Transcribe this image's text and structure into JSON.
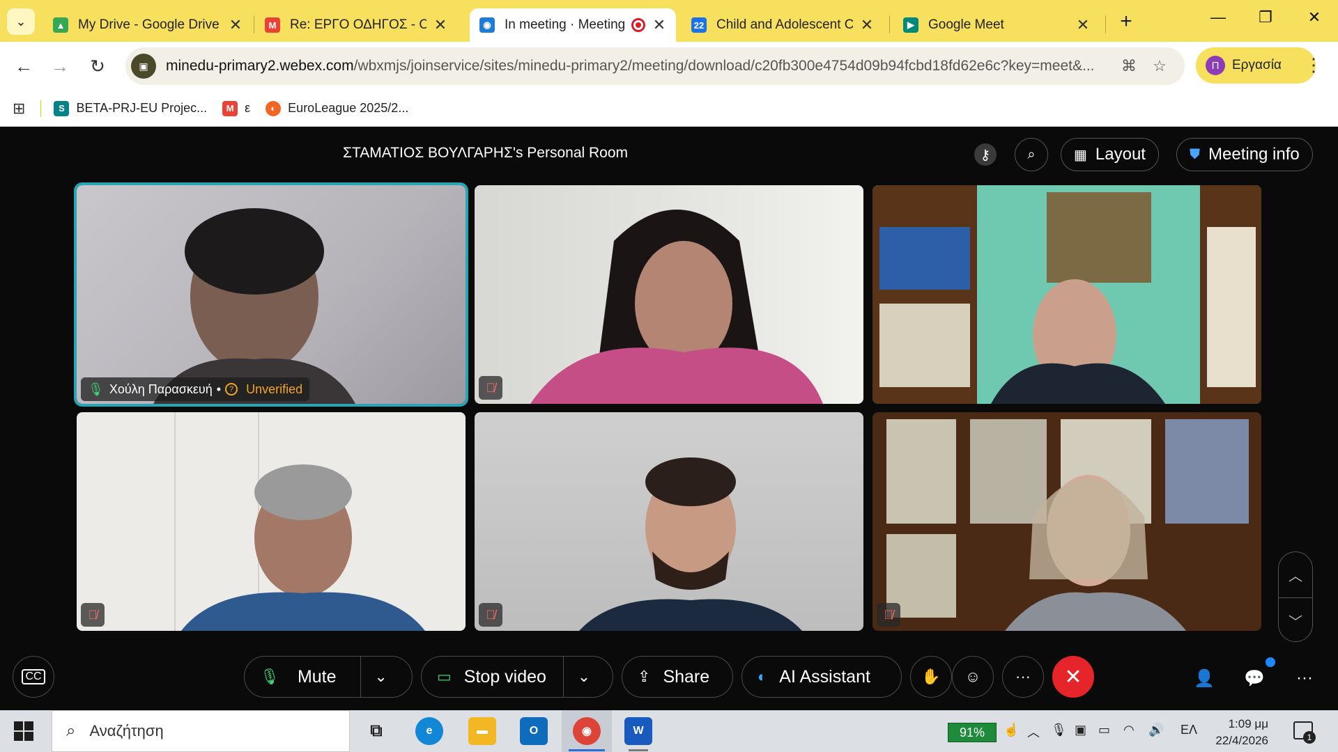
{
  "browser": {
    "tabs": [
      {
        "title": "My Drive - Google Drive",
        "icon": "google-drive-icon",
        "color": "#34a853"
      },
      {
        "title": "Re: ΕΡΓΟ ΟΔΗΓΟΣ - ΟΡΙΣ",
        "icon": "gmail-icon",
        "color": "#ea4335"
      },
      {
        "title": "In meeting · Meeting",
        "icon": "webex-icon",
        "color": "#1e7bd8",
        "active": true,
        "recording": true
      },
      {
        "title": "Child and Adolescent Cer",
        "icon": "calendar-icon",
        "color": "#1a73e8"
      },
      {
        "title": "Google Meet",
        "icon": "google-meet-icon",
        "color": "#00897b"
      }
    ],
    "url_host": "minedu-primary2.webex.com",
    "url_path": "/wbxmjs/joinservice/sites/minedu-primary2/meeting/download/c20fb300e4754d09b94fcbd18fd62e6c?key=meet&...",
    "profile_initial": "Π",
    "profile_name": "Εργασία",
    "bookmarks": [
      {
        "label": "BETA-PRJ-EU Projec...",
        "icon": "sharepoint-icon",
        "color": "#038387"
      },
      {
        "label": "ε",
        "icon": "gmail-icon",
        "color": "#ea4335"
      },
      {
        "label": "EuroLeague 2025/2...",
        "icon": "euroleague-icon",
        "color": "#f26522"
      }
    ]
  },
  "meeting": {
    "room_title": "ΣΤΑΜΑΤΙΟΣ ΒΟΥΛΓΑΡΗΣ's Personal Room",
    "layout_label": "Layout",
    "meeting_info_label": "Meeting info",
    "active_speaker_name": "Χούλη Παρασκευή",
    "active_speaker_status": "Unverified",
    "participants_count_visible": 6
  },
  "controls": {
    "mute_label": "Mute",
    "stop_video_label": "Stop video",
    "share_label": "Share",
    "ai_label": "AI Assistant"
  },
  "taskbar": {
    "search_placeholder": "Αναζήτηση",
    "battery": "91%",
    "language": "ΕΛ",
    "time": "1:09 μμ",
    "date": "22/4/2026",
    "notifications": "1"
  },
  "colors": {
    "chrome_accent": "#f6e05e",
    "active_speaker_border": "#27a5b4",
    "end_call": "#e5252a",
    "unverified": "#f5a524"
  }
}
